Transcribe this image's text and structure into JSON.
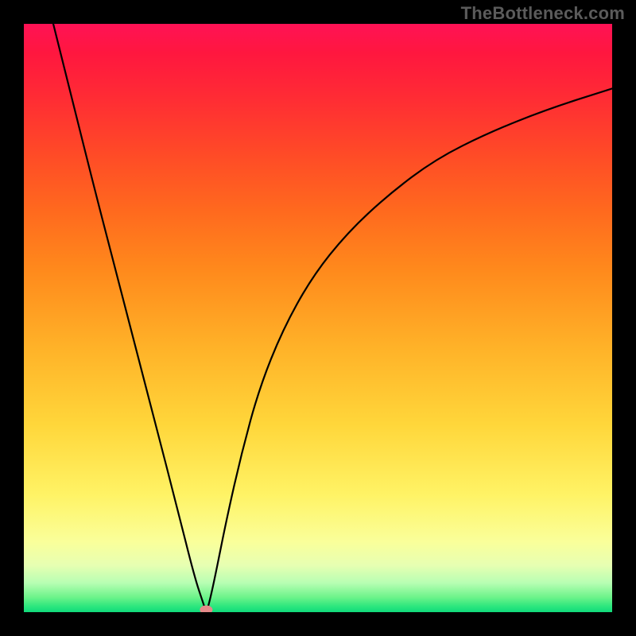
{
  "watermark": "TheBottleneck.com",
  "chart_data": {
    "type": "line",
    "title": "",
    "xlabel": "",
    "ylabel": "",
    "xlim": [
      0,
      1
    ],
    "ylim": [
      0,
      1
    ],
    "background_gradient": {
      "top": "#ff1255",
      "middle": "#ffd63a",
      "bottom": "#10da7b"
    },
    "series": [
      {
        "name": "curve",
        "color": "#000000",
        "x": [
          0.05,
          0.085,
          0.12,
          0.155,
          0.19,
          0.225,
          0.26,
          0.29,
          0.305,
          0.31,
          0.315,
          0.325,
          0.345,
          0.37,
          0.4,
          0.44,
          0.49,
          0.55,
          0.62,
          0.7,
          0.79,
          0.89,
          1.0
        ],
        "y": [
          1.0,
          0.86,
          0.72,
          0.585,
          0.45,
          0.315,
          0.18,
          0.06,
          0.015,
          0.0,
          0.015,
          0.06,
          0.16,
          0.27,
          0.38,
          0.48,
          0.57,
          0.645,
          0.71,
          0.77,
          0.815,
          0.855,
          0.89
        ]
      }
    ],
    "marker": {
      "x": 0.31,
      "y": 0.0,
      "color": "#e58a8a"
    }
  }
}
